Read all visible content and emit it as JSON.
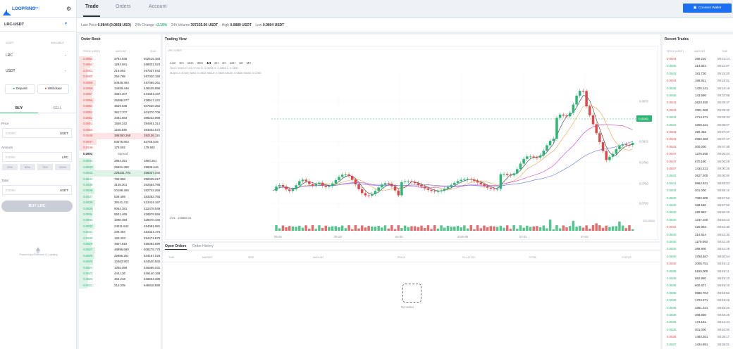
{
  "brand": {
    "logo": "LOOPRING",
    "beta": "Beta1"
  },
  "sidebar": {
    "market": "LRC-USDT",
    "asset_header": "ASSET",
    "available_header": "AVAILABLE",
    "assets": [
      {
        "name": "LRC",
        "value": "-"
      },
      {
        "name": "USDT",
        "value": "-"
      }
    ],
    "deposit": "Deposit",
    "withdraw": "Withdraw",
    "buy_tab": "BUY",
    "sell_tab": "SELL",
    "price_label": "Price",
    "price_placeholder": "0.0000",
    "price_unit": "USDT",
    "amount_label": "Amount",
    "amount_placeholder": "0.0000",
    "amount_unit": "LRC",
    "percents": [
      "25%",
      "50%",
      "75%",
      "100%"
    ],
    "total_label": "Total",
    "total_placeholder": "0.0000",
    "total_unit": "USDT",
    "buy_button": "BUY LRC",
    "powered": "Powered by Ethereum & Loopring"
  },
  "nav": {
    "tabs": [
      "Trade",
      "Orders",
      "Account"
    ],
    "active": 0,
    "connect": "Connect Wallet"
  },
  "ticker": {
    "last_label": "Last Price",
    "last_value": "0.0844 (0.0858 USD)",
    "change_label": "24h Change",
    "change_value": "+2.19%",
    "volume_label": "24h Volume",
    "volume_value": "307225.00 USDT",
    "high_label": "High",
    "high_value": "0.0889 USDT",
    "low_label": "Low",
    "low_value": "0.0804 USDT"
  },
  "orderbook": {
    "title": "Order Book",
    "headers": [
      "PRICE (USDT)",
      "AMOUNT",
      "SUM"
    ],
    "asks": [
      [
        "0.0864",
        "3784.836",
        "502616.483"
      ],
      [
        "0.0864",
        "1284.581",
        "498831.623"
      ],
      [
        "0.0861",
        "216.692",
        "497537.042"
      ],
      [
        "0.0860",
        "250.788",
        "497320.150"
      ],
      [
        "0.0859",
        "50645.464",
        "497069.261"
      ],
      [
        "0.0858",
        "14469.446",
        "446435.896"
      ],
      [
        "0.0857",
        "3334.207",
        "431551.447"
      ],
      [
        "0.0856",
        "25086.877",
        "428617.241"
      ],
      [
        "0.0854",
        "3649.636",
        "407620.362"
      ],
      [
        "0.0852",
        "3617.707",
        "401070.706"
      ],
      [
        "0.0852",
        "3481.684",
        "398232.998"
      ],
      [
        "0.0851",
        "1559.242",
        "394801.314"
      ],
      [
        "0.0850",
        "1165.936",
        "393302.072"
      ],
      [
        "0.0849",
        "386360.368",
        "392136.115"
      ],
      [
        "0.0847",
        "83575.803",
        "83755.645"
      ],
      [
        "0.0846",
        "179.592",
        "179.592"
      ]
    ],
    "spread_price": "0.0802",
    "spread_label": "Spread",
    "bids": [
      [
        "0.0844",
        "2864.251",
        "2864.251"
      ],
      [
        "0.0843",
        "26831.396",
        "29695.646"
      ],
      [
        "0.0842",
        "228331.701",
        "258027.346"
      ],
      [
        "0.0841",
        "780.868",
        "258405.217"
      ],
      [
        "0.0839",
        "3146.301",
        "262554.785"
      ],
      [
        "0.0838",
        "20188.465",
        "282742.265"
      ],
      [
        "0.0837",
        "539.489",
        "283282.755"
      ],
      [
        "0.0836",
        "39141.411",
        "413424.167"
      ],
      [
        "0.0835",
        "9054.381",
        "422478.549"
      ],
      [
        "0.0834",
        "6501.465",
        "428979.555"
      ],
      [
        "0.0833",
        "1090.393",
        "428070.340"
      ],
      [
        "0.0832",
        "24011.642",
        "454081.981"
      ],
      [
        "0.0831",
        "239.484",
        "454321.475"
      ],
      [
        "0.0830",
        "153.403",
        "454474.879"
      ],
      [
        "0.0829",
        "4807.819",
        "459282.699"
      ],
      [
        "0.0827",
        "48996.690",
        "508278.779"
      ],
      [
        "0.0826",
        "25886.251",
        "534167.029"
      ],
      [
        "0.0825",
        "10463.903",
        "544630.932"
      ],
      [
        "0.0824",
        "1065.096",
        "545696.031"
      ],
      [
        "0.0823",
        "444.136",
        "546140.168"
      ],
      [
        "0.0822",
        "464.216",
        "546604.385"
      ],
      [
        "0.0821",
        "214.205",
        "546818.590"
      ]
    ]
  },
  "trading": {
    "title": "Trading View",
    "symbol": "LRC-USDT",
    "intervals": [
      "Line",
      "5m",
      "15m",
      "30m",
      "1H",
      "2H",
      "4H",
      "12H",
      "1D",
      "MA"
    ],
    "active_interval": 4,
    "ohlc": "Time: 2020-07-03 07:00  O: 0.0834  H: 0.0835  L: 0.0831",
    "ma_line": "MA(5,10,30,60)  MA5: 0.0832  MA10: 0.0823  MA30: 0.0826  MA60: 0.0785",
    "price_ticks": [
      "0.0870",
      "0.0815",
      "0.0780",
      "0.0750",
      "0.0720"
    ],
    "current_price": "0.0849",
    "vol_label": "VOL",
    "vol_value": "105885.24",
    "vol_axis": "220.0000",
    "time_ticks": [
      "06-28",
      "06-29",
      "02:00",
      "2020-06",
      "07-01",
      "07-02"
    ]
  },
  "orders": {
    "tabs": [
      "Open Orders",
      "Order History"
    ],
    "headers": [
      "TIME",
      "MARKET",
      "SIDE",
      "AMOUNT",
      "PRICE",
      "FILL/FOTO",
      "TOTAL",
      "STATUS"
    ],
    "empty": "No orders"
  },
  "recent": {
    "title": "Recent Trades",
    "headers": [
      "PRICE (USDT)",
      "AMOUNT",
      "TIME"
    ],
    "trades": [
      [
        "0.0844",
        "369.210",
        "09:22:14",
        "r"
      ],
      [
        "0.0845",
        "314.822",
        "09:22:07",
        "g"
      ],
      [
        "0.0843",
        "181.730",
        "09:19:20",
        "g"
      ],
      [
        "0.0844",
        "168.811",
        "09:18:01",
        "r"
      ],
      [
        "0.0846",
        "1425.141",
        "09:16:19",
        "g"
      ],
      [
        "0.0845",
        "143.596",
        "09:10:08",
        "g"
      ],
      [
        "0.0843",
        "2623.450",
        "09:09:37",
        "r"
      ],
      [
        "0.0843",
        "3301.069",
        "09:09:32",
        "r"
      ],
      [
        "0.0843",
        "2714.371",
        "09:08:33",
        "g"
      ],
      [
        "0.0842",
        "3259.221",
        "09:08:07",
        "g"
      ],
      [
        "0.0843",
        "259.453",
        "09:07:47",
        "r"
      ],
      [
        "0.0843",
        "2060.383",
        "09:07:47",
        "r"
      ],
      [
        "0.0843",
        "300.000",
        "09:07:38",
        "r"
      ],
      [
        "0.0847",
        "1376.455",
        "09:00:34",
        "r"
      ],
      [
        "0.0847",
        "670.190",
        "09:00:28",
        "r"
      ],
      [
        "0.0847",
        "1434.221",
        "09:00:26",
        "r"
      ],
      [
        "0.0842",
        "3627.200",
        "09:00:00",
        "g"
      ],
      [
        "0.0841",
        "9962.931",
        "08:59:03",
        "g"
      ],
      [
        "0.0843",
        "301.000",
        "08:58:10",
        "g"
      ],
      [
        "0.0840",
        "7083.300",
        "08:57:52",
        "g"
      ],
      [
        "0.0840",
        "369.630",
        "08:57:52",
        "g"
      ],
      [
        "0.0840",
        "282.982",
        "08:55:42",
        "g"
      ],
      [
        "0.0840",
        "1247.100",
        "08:53:44",
        "g"
      ],
      [
        "0.0842",
        "420.053",
        "08:51:30",
        "r"
      ],
      [
        "0.0840",
        "314.814",
        "08:51:30",
        "g"
      ],
      [
        "0.0840",
        "1179.093",
        "08:51:49",
        "g"
      ],
      [
        "0.0840",
        "389.800",
        "08:51:48",
        "g"
      ],
      [
        "0.0840",
        "3758.487",
        "08:50:54",
        "g"
      ],
      [
        "0.0840",
        "2005.751",
        "08:49:12",
        "r"
      ],
      [
        "0.0838",
        "5160.000",
        "08:49:11",
        "g"
      ],
      [
        "0.0838",
        "652.850",
        "08:49:10",
        "g"
      ],
      [
        "0.0838",
        "600.671",
        "08:49:10",
        "g"
      ],
      [
        "0.0838",
        "9986.704",
        "08:48:56",
        "g"
      ],
      [
        "0.0838",
        "1723.371",
        "08:48:49",
        "g"
      ],
      [
        "0.0838",
        "3361.221",
        "08:48:20",
        "g"
      ],
      [
        "0.0838",
        "368.836",
        "08:48:25",
        "g"
      ],
      [
        "0.0836",
        "173.181",
        "08:41:34",
        "g"
      ],
      [
        "0.0835",
        "301.000",
        "08:40:00",
        "g"
      ],
      [
        "0.0835",
        "1483.261",
        "08:39:17",
        "r"
      ],
      [
        "0.0837",
        "1434.991",
        "08:38:01",
        "g"
      ]
    ]
  },
  "colors": {
    "accent": "#1d6ff2",
    "up": "#2bb673",
    "down": "#e04848"
  }
}
